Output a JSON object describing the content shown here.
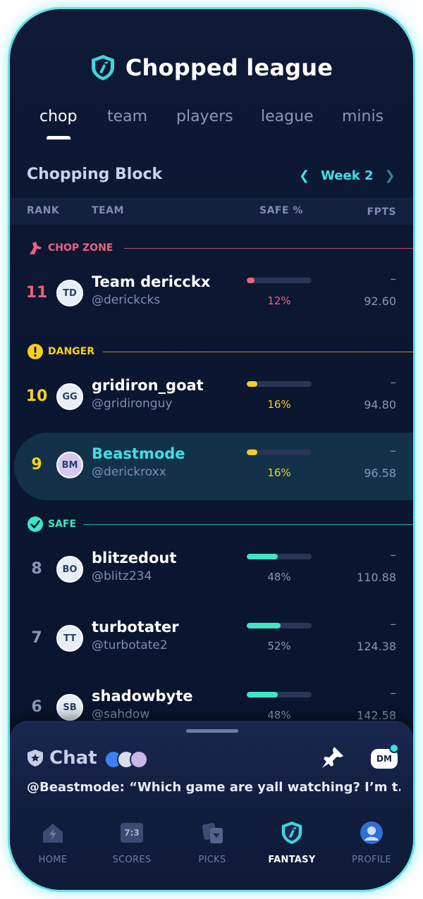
{
  "app": {
    "title": "Chopped league"
  },
  "tabs": [
    {
      "label": "chop"
    },
    {
      "label": "team"
    },
    {
      "label": "players"
    },
    {
      "label": "league"
    },
    {
      "label": "minis"
    }
  ],
  "section": {
    "title": "Chopping Block",
    "week": "Week 2"
  },
  "columns": {
    "rank": "RANK",
    "team": "TEAM",
    "safe": "SAFE %",
    "fpts": "FPTS"
  },
  "zones": {
    "chop": {
      "label": "CHOP ZONE",
      "color": "#f0607e"
    },
    "danger": {
      "label": "DANGER",
      "color": "#f5cf1f"
    },
    "safe": {
      "label": "SAFE",
      "color": "#3ee6c4"
    }
  },
  "rows": [
    {
      "rank": "11",
      "name": "Team dericckx",
      "handle": "@derickcks",
      "safe_pct": "12%",
      "safe_value": 0.12,
      "dash": "–",
      "fpts": "92.60"
    },
    {
      "rank": "10",
      "name": "gridiron_goat",
      "handle": "@gridironguy",
      "safe_pct": "16%",
      "safe_value": 0.16,
      "dash": "–",
      "fpts": "94.80"
    },
    {
      "rank": "9",
      "name": "Beastmode",
      "handle": "@derickroxx",
      "safe_pct": "16%",
      "safe_value": 0.16,
      "dash": "–",
      "fpts": "96.58"
    },
    {
      "rank": "8",
      "name": "blitzedout",
      "handle": "@blitz234",
      "safe_pct": "48%",
      "safe_value": 0.48,
      "dash": "–",
      "fpts": "110.88"
    },
    {
      "rank": "7",
      "name": "turbotater",
      "handle": "@turbotate2",
      "safe_pct": "52%",
      "safe_value": 0.52,
      "dash": "–",
      "fpts": "124.38"
    },
    {
      "rank": "6",
      "name": "shadowbyte",
      "handle": "@sahdow",
      "safe_pct": "48%",
      "safe_value": 0.48,
      "dash": "–",
      "fpts": "142.58"
    }
  ],
  "chat": {
    "title": "Chat",
    "dm_label": "DM",
    "message": "@Beastmode: “Which game are yall watching? I’m t..."
  },
  "nav": [
    {
      "label": "HOME",
      "icon": "home-icon"
    },
    {
      "label": "SCORES",
      "icon": "scoreboard-icon"
    },
    {
      "label": "PICKS",
      "icon": "picks-icon"
    },
    {
      "label": "FANTASY",
      "icon": "fantasy-shield-icon"
    },
    {
      "label": "PROFILE",
      "icon": "profile-avatar-icon"
    }
  ],
  "nav_score_glyph": "7:3"
}
